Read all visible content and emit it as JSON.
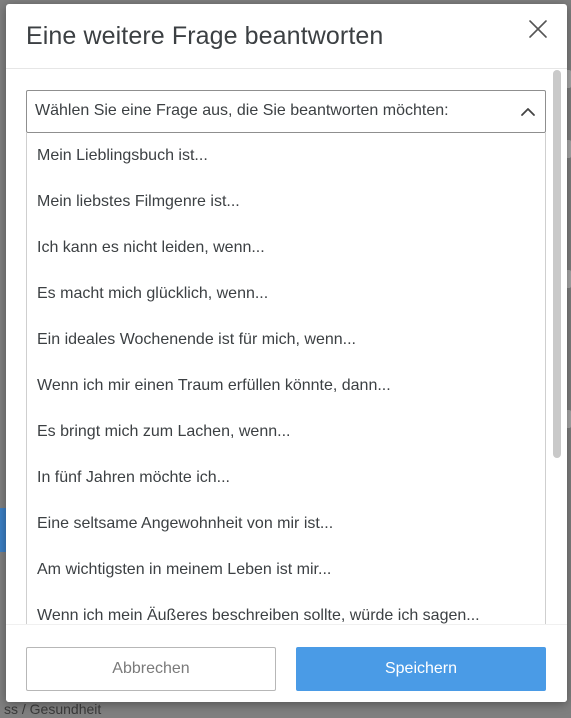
{
  "background": {
    "bottom_text": "ss / Gesundheit"
  },
  "modal": {
    "title": "Eine weitere Frage beantworten",
    "close_icon": "close-icon"
  },
  "select": {
    "placeholder": "Wählen Sie eine Frage aus, die Sie beantworten möchten:",
    "icon": "chevron-up-icon"
  },
  "options": [
    "Mein Lieblingsbuch ist...",
    "Mein liebstes Filmgenre ist...",
    "Ich kann es nicht leiden, wenn...",
    "Es macht mich glücklich, wenn...",
    "Ein ideales Wochenende ist für mich, wenn...",
    "Wenn ich mir einen Traum erfüllen könnte, dann...",
    "Es bringt mich zum Lachen, wenn...",
    "In fünf Jahren möchte ich...",
    "Eine seltsame Angewohnheit von mir ist...",
    "Am wichtigsten in meinem Leben ist mir...",
    "Wenn ich mein Äußeres beschreiben sollte, würde ich sagen..."
  ],
  "footer": {
    "cancel_label": "Abbrechen",
    "save_label": "Speichern"
  },
  "colors": {
    "primary": "#4a9be6",
    "text": "#3c4043",
    "border": "#8f8f8f"
  }
}
